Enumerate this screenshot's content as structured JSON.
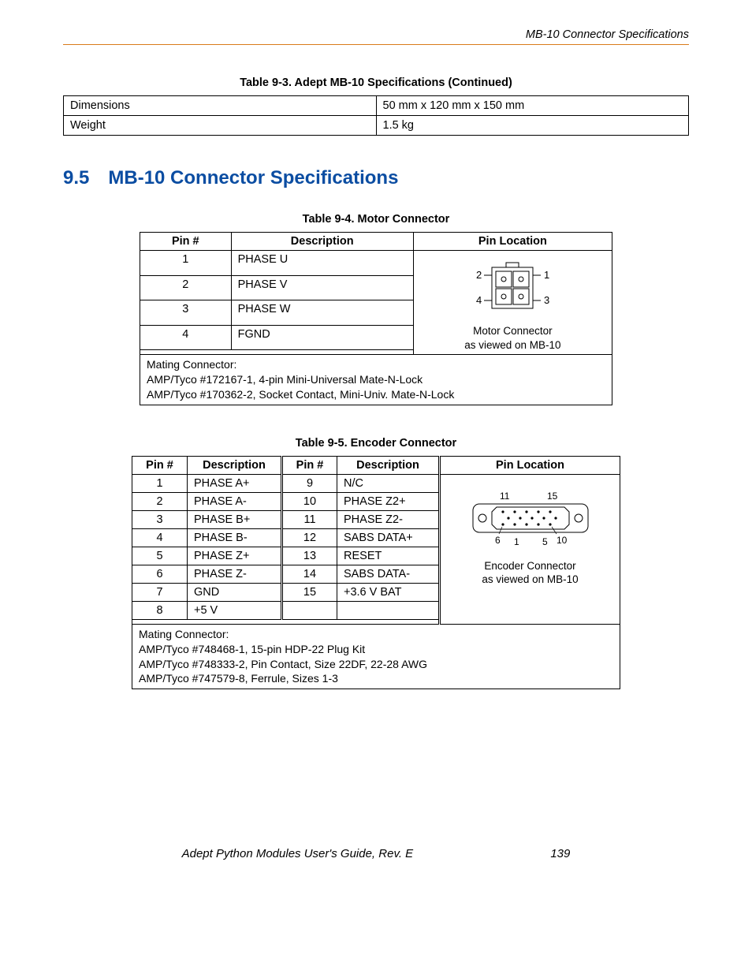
{
  "header": {
    "running": "MB-10 Connector Specifications"
  },
  "section": {
    "number": "9.5",
    "title": "MB-10 Connector Specifications"
  },
  "table93": {
    "caption": "Table 9-3. Adept MB-10 Specifications (Continued)",
    "rows": [
      {
        "k": "Dimensions",
        "v": "50 mm x 120 mm x 150 mm"
      },
      {
        "k": "Weight",
        "v": "1.5 kg"
      }
    ]
  },
  "table94": {
    "caption": "Table 9-4. Motor Connector",
    "headers": {
      "pin": "Pin #",
      "desc": "Description",
      "loc": "Pin Location"
    },
    "rows": [
      {
        "pin": "1",
        "desc": "PHASE U"
      },
      {
        "pin": "2",
        "desc": "PHASE V"
      },
      {
        "pin": "3",
        "desc": "PHASE W"
      },
      {
        "pin": "4",
        "desc": "FGND"
      }
    ],
    "diagram": {
      "labels": {
        "p1": "1",
        "p2": "2",
        "p3": "3",
        "p4": "4"
      },
      "caption1": "Motor Connector",
      "caption2": "as viewed on MB-10"
    },
    "mating": {
      "title": "Mating Connector:",
      "lines": [
        "AMP/Tyco #172167-1, 4-pin Mini-Universal Mate-N-Lock",
        "AMP/Tyco #170362-2, Socket Contact, Mini-Univ. Mate-N-Lock"
      ]
    }
  },
  "table95": {
    "caption": "Table 9-5. Encoder Connector",
    "headers": {
      "pin": "Pin #",
      "desc": "Description",
      "loc": "Pin Location"
    },
    "rows_left": [
      {
        "pin": "1",
        "desc": "PHASE A+"
      },
      {
        "pin": "2",
        "desc": "PHASE A-"
      },
      {
        "pin": "3",
        "desc": "PHASE B+"
      },
      {
        "pin": "4",
        "desc": "PHASE B-"
      },
      {
        "pin": "5",
        "desc": "PHASE Z+"
      },
      {
        "pin": "6",
        "desc": "PHASE Z-"
      },
      {
        "pin": "7",
        "desc": "GND"
      },
      {
        "pin": "8",
        "desc": "+5 V"
      }
    ],
    "rows_right": [
      {
        "pin": "9",
        "desc": "N/C"
      },
      {
        "pin": "10",
        "desc": "PHASE Z2+"
      },
      {
        "pin": "11",
        "desc": "PHASE Z2-"
      },
      {
        "pin": "12",
        "desc": "SABS DATA+"
      },
      {
        "pin": "13",
        "desc": "RESET"
      },
      {
        "pin": "14",
        "desc": "SABS DATA-"
      },
      {
        "pin": "15",
        "desc": "+3.6 V BAT"
      },
      {
        "pin": "",
        "desc": ""
      }
    ],
    "diagram": {
      "labels": {
        "p1": "1",
        "p5": "5",
        "p6": "6",
        "p10": "10",
        "p11": "11",
        "p15": "15"
      },
      "caption1": "Encoder Connector",
      "caption2": "as viewed on MB-10"
    },
    "mating": {
      "title": "Mating Connector:",
      "lines": [
        "AMP/Tyco #748468-1, 15-pin HDP-22 Plug Kit",
        "AMP/Tyco #748333-2, Pin Contact, Size 22DF, 22-28 AWG",
        "AMP/Tyco #747579-8, Ferrule, Sizes 1-3"
      ]
    }
  },
  "footer": {
    "title": "Adept Python Modules User's Guide, Rev. E",
    "page": "139"
  }
}
